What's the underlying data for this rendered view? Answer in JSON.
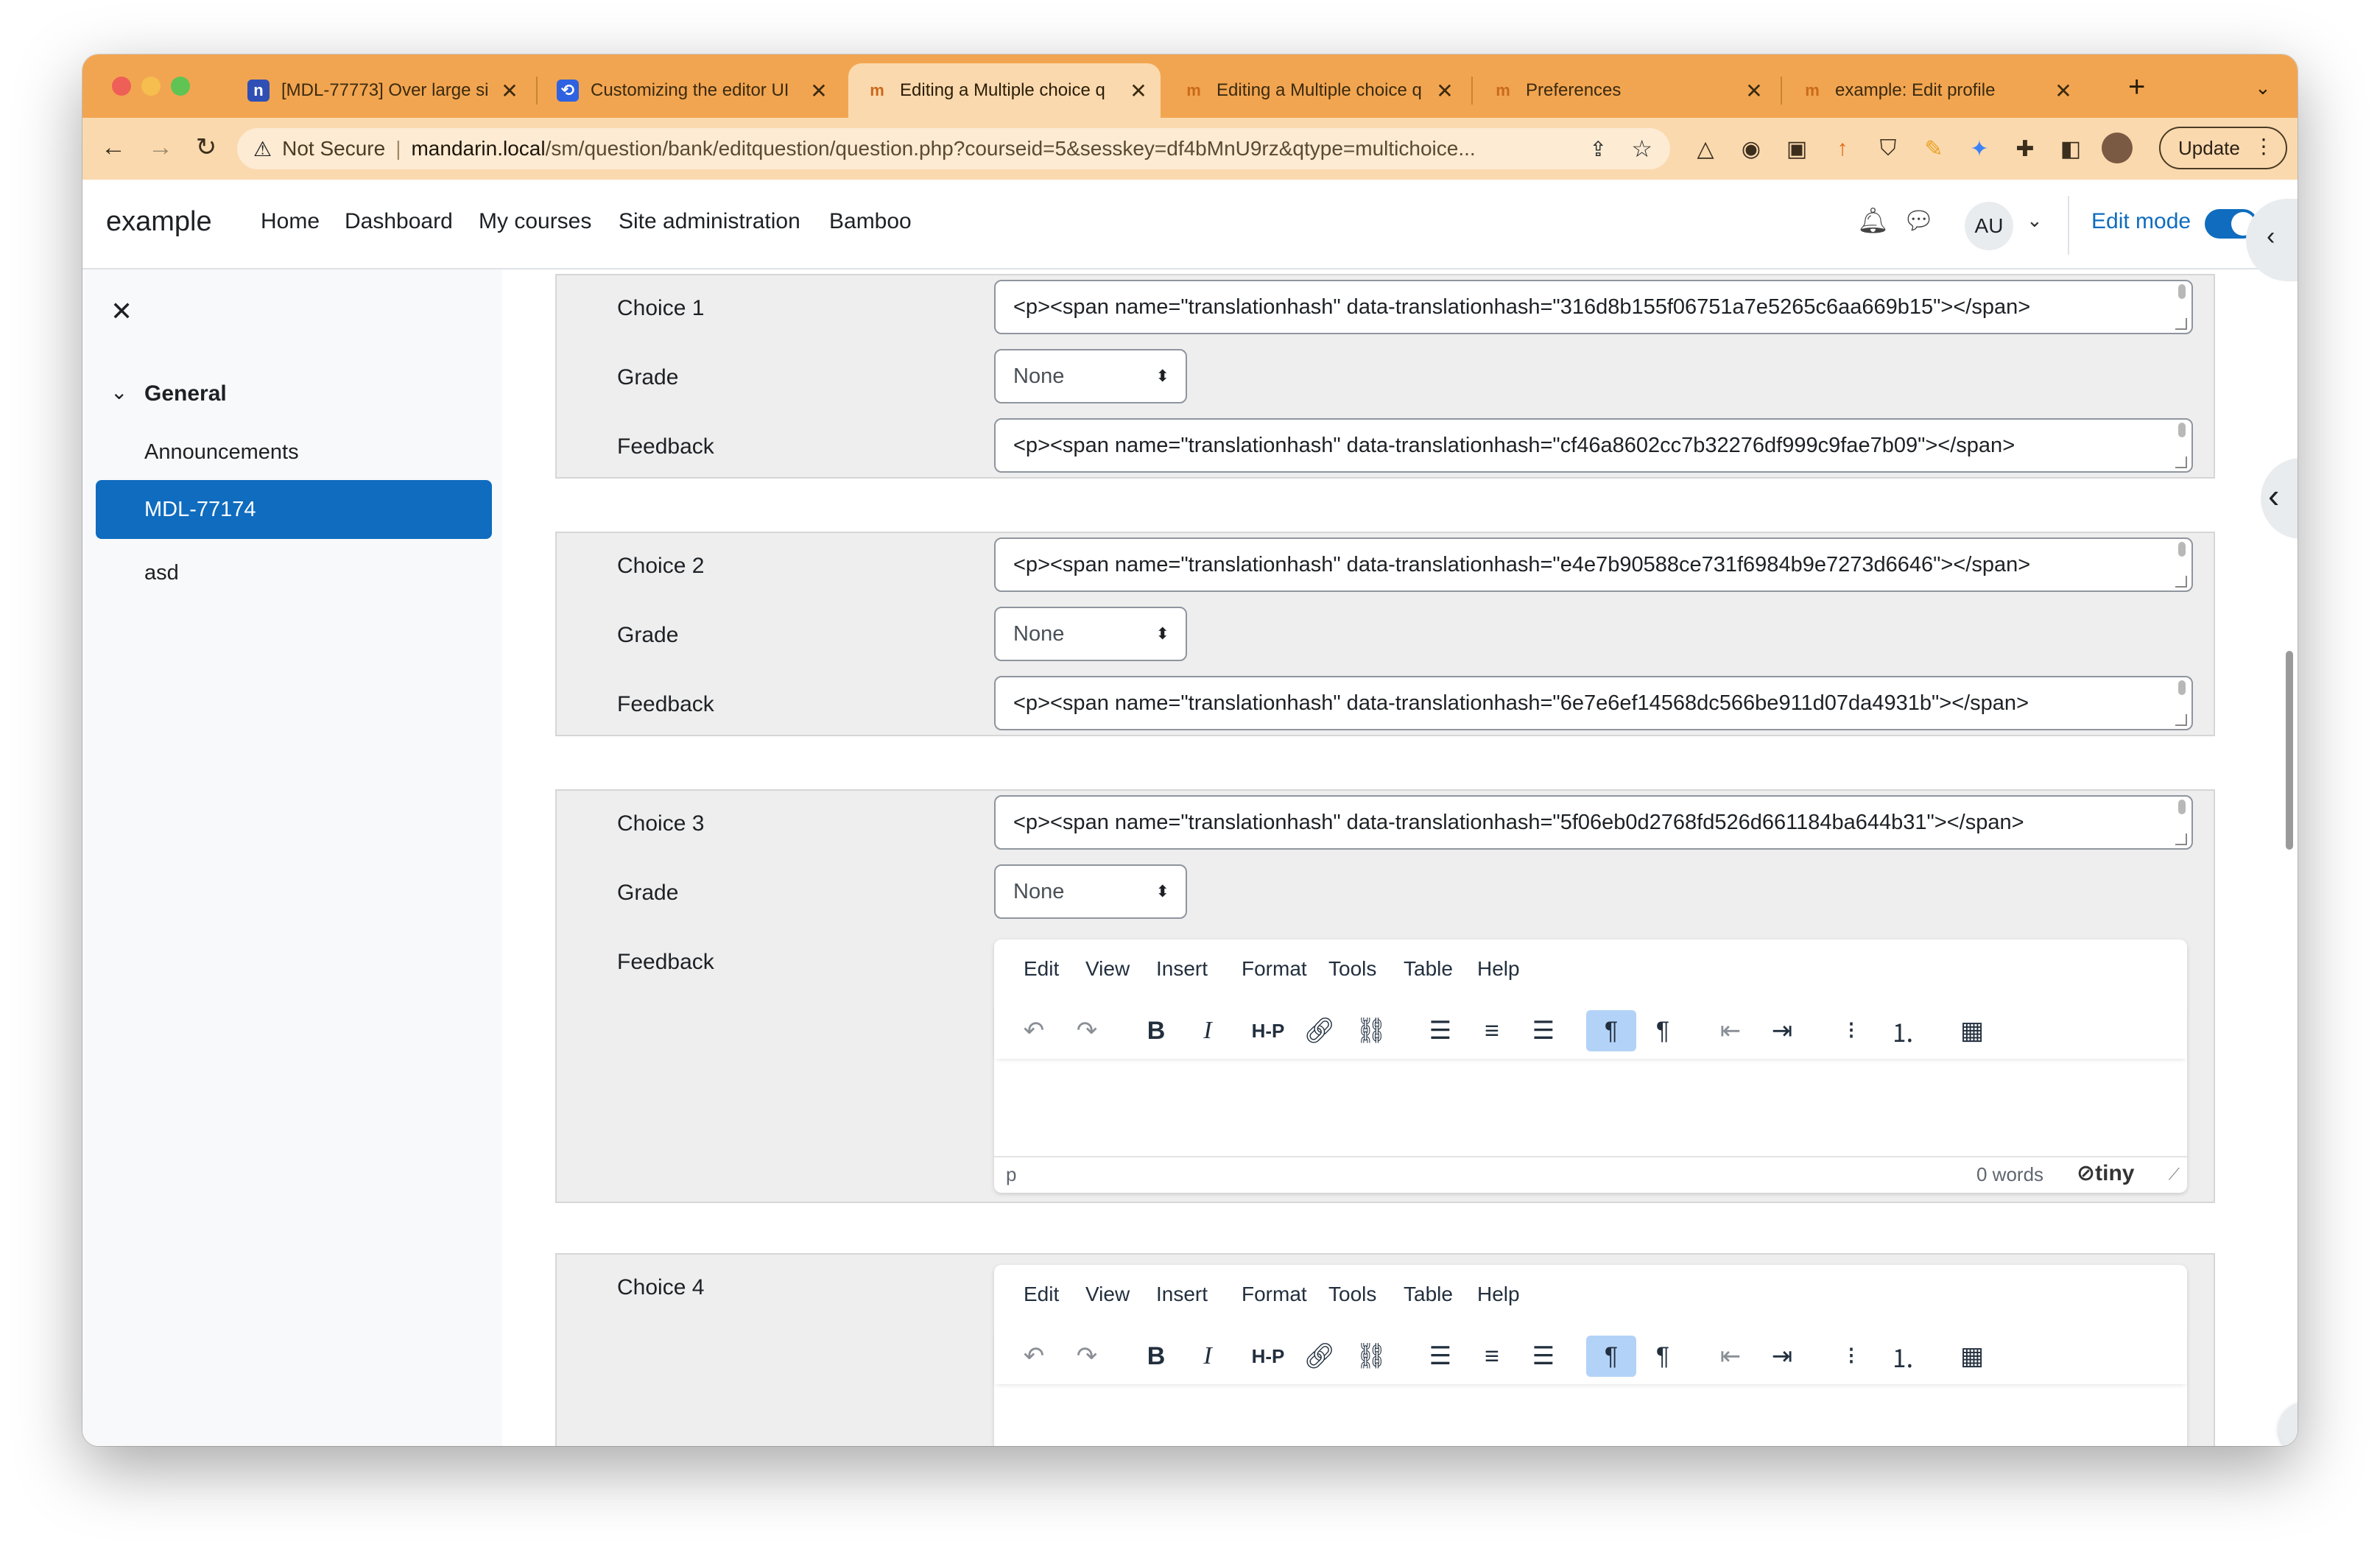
{
  "browser": {
    "tabs": [
      {
        "title": "[MDL-77773] Over large si",
        "favicon": "jira-icon"
      },
      {
        "title": "Customizing the editor UI",
        "favicon": "confluence-icon"
      },
      {
        "title": "Editing a Multiple choice q",
        "favicon": "moodle-icon"
      },
      {
        "title": "Editing a Multiple choice q",
        "favicon": "moodle-icon"
      },
      {
        "title": "Preferences",
        "favicon": "moodle-icon"
      },
      {
        "title": "example: Edit profile",
        "favicon": "moodle-icon"
      }
    ],
    "active_tab": 2,
    "url_security": "Not Secure",
    "url_host": "mandarin.local",
    "url_path": "/sm/question/bank/editquestion/question.php?courseid=5&sesskey=df4bMnU9rz&qtype=multichoice...",
    "update_label": "Update",
    "colors": {
      "titlebar": "#f2a550",
      "toolbar": "#fbd9ae"
    }
  },
  "site": {
    "brand": "example",
    "nav": [
      "Home",
      "Dashboard",
      "My courses",
      "Site administration",
      "Bamboo"
    ],
    "user_initials": "AU",
    "edit_mode_label": "Edit mode",
    "edit_mode_on": true
  },
  "drawer": {
    "section": "General",
    "items": [
      "Announcements",
      "MDL-77174",
      "asd"
    ],
    "active_item": "MDL-77174",
    "accent": "#0f6cbf"
  },
  "choices": [
    {
      "label": "Choice 1",
      "value": "<p><span name=\"translationhash\" data-translationhash=\"316d8b155f06751a7e5265c6aa669b15\"></span>",
      "grade_label": "Grade",
      "grade": "None",
      "feedback_label": "Feedback",
      "feedback": "<p><span name=\"translationhash\" data-translationhash=\"cf46a8602cc7b32276df999c9fae7b09\"></span>"
    },
    {
      "label": "Choice 2",
      "value": "<p><span name=\"translationhash\" data-translationhash=\"e4e7b90588ce731f6984b9e7273d6646\"></span>",
      "grade_label": "Grade",
      "grade": "None",
      "feedback_label": "Feedback",
      "feedback": "<p><span name=\"translationhash\" data-translationhash=\"6e7e6ef14568dc566be911d07da4931b\"></span>"
    },
    {
      "label": "Choice 3",
      "value": "<p><span name=\"translationhash\" data-translationhash=\"5f06eb0d2768fd526d661184ba644b31\"></span>",
      "grade_label": "Grade",
      "grade": "None",
      "feedback_label": "Feedback"
    },
    {
      "label": "Choice 4"
    }
  ],
  "editor": {
    "menu": [
      "Edit",
      "View",
      "Insert",
      "Format",
      "Tools",
      "Table",
      "Help"
    ],
    "tools": [
      "undo-icon",
      "redo-icon",
      "bold-icon",
      "italic-icon",
      "h5p-icon",
      "link-icon",
      "unlink-icon",
      "align-left-icon",
      "align-center-icon",
      "align-right-icon",
      "ltr-icon",
      "rtl-icon",
      "outdent-icon",
      "indent-icon",
      "bullet-list-icon",
      "numbered-list-icon",
      "calculator-icon"
    ],
    "status_path": "p",
    "word_count": "0 words",
    "brand": "tiny"
  }
}
